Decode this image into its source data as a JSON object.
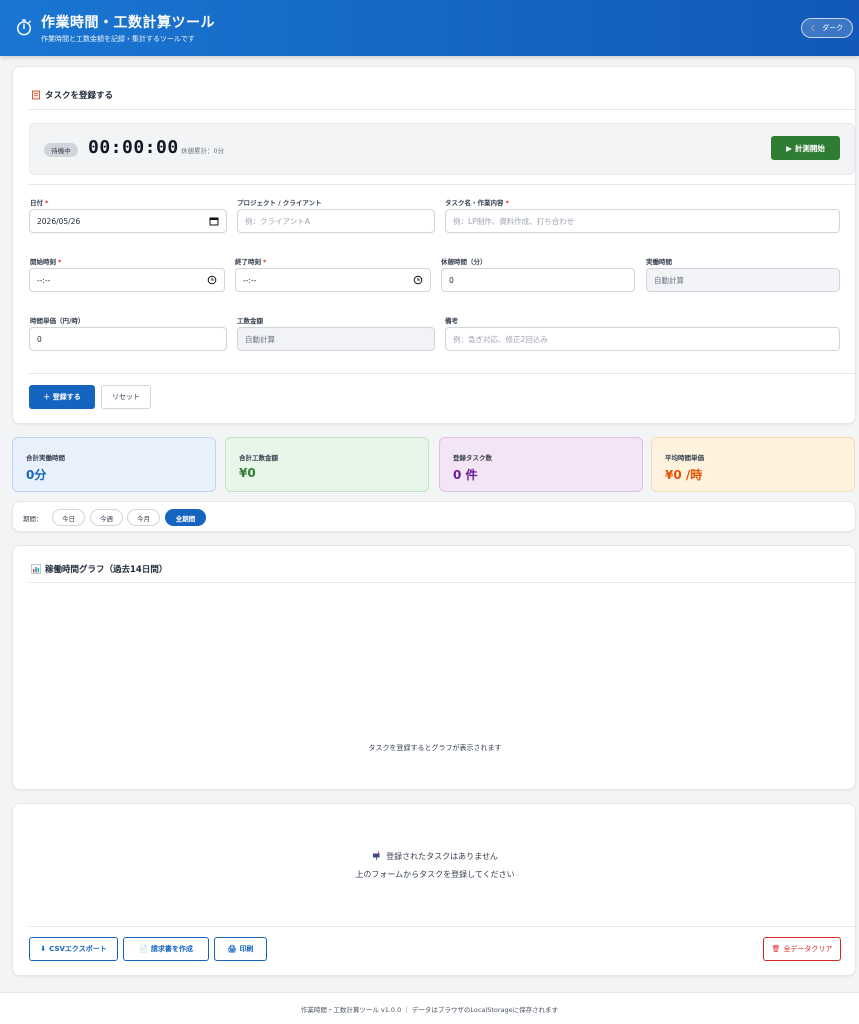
{
  "header": {
    "title": "作業時間・工数計算ツール",
    "subtitle": "作業時間と工数金額を記録・集計するツールです",
    "theme_label": "ダーク",
    "logo_icon": "stopwatch-icon",
    "theme_icon": "moon-icon"
  },
  "register": {
    "title": "タスクを登録する",
    "title_icon": "memo-icon",
    "timer": {
      "status": "待機中",
      "display": "00:00:00",
      "break_total": "休憩累計：0分",
      "start_label": "計測開始",
      "start_icon": "play-icon"
    },
    "fields": {
      "date": {
        "label": "日付",
        "required": "*",
        "value": "2026/05/26"
      },
      "project": {
        "label": "プロジェクト / クライアント",
        "placeholder": "例：クライアントA"
      },
      "task": {
        "label": "タスク名・作業内容",
        "required": "*",
        "placeholder": "例：LP制作、資料作成、打ち合わせ"
      },
      "start_time": {
        "label": "開始時刻",
        "required": "*",
        "value": "--:--"
      },
      "end_time": {
        "label": "終了時刻",
        "required": "*",
        "value": "--:--"
      },
      "break_min": {
        "label": "休憩時間（分）",
        "value": "0"
      },
      "actual_time": {
        "label": "実働時間",
        "value": "自動計算"
      },
      "hourly_rate": {
        "label": "時間単価（円/時）",
        "value": "0"
      },
      "cost": {
        "label": "工数金額",
        "value": "自動計算"
      },
      "notes": {
        "label": "備考",
        "placeholder": "例：急ぎ対応、修正2回込み"
      }
    },
    "submit_label": "＋ 登録する",
    "reset_label": "リセット"
  },
  "stats": [
    {
      "label": "合計実働時間",
      "value": "0分",
      "color": "#1565c0",
      "bg": "#e8f0fc",
      "border": "#bfd4f2"
    },
    {
      "label": "合計工数金額",
      "value": "¥0",
      "color": "#2e7d32",
      "bg": "#e8f5e9",
      "border": "#c3e3c5"
    },
    {
      "label": "登録タスク数",
      "value": "0 件",
      "color": "#6a1b9a",
      "bg": "#f3e5f5",
      "border": "#ddc2e6"
    },
    {
      "label": "平均時間単価",
      "value": "¥0 /時",
      "color": "#e65100",
      "bg": "#fff3e0",
      "border": "#f5d9b0"
    }
  ],
  "period": {
    "label": "期間：",
    "options": [
      "今日",
      "今週",
      "今月",
      "全期間"
    ],
    "selected": "全期間"
  },
  "chart": {
    "title": "稼働時間グラフ（過去14日間）",
    "title_icon": "bar-chart-icon",
    "empty_message": "タスクを登録するとグラフが表示されます"
  },
  "task_list": {
    "empty_line1": "登録されたタスクはありません",
    "empty_line2": "上のフォームからタスクを登録してください",
    "empty_icon": "mailbox-icon",
    "csv_label": "CSVエクスポート",
    "invoice_label": "請求書を作成",
    "print_label": "印刷",
    "clear_label": "全データクリア"
  },
  "footer": {
    "text": "作業時間・工数計算ツール v1.0.0 ｜ データはブラウザのLocalStorageに保存されます"
  }
}
